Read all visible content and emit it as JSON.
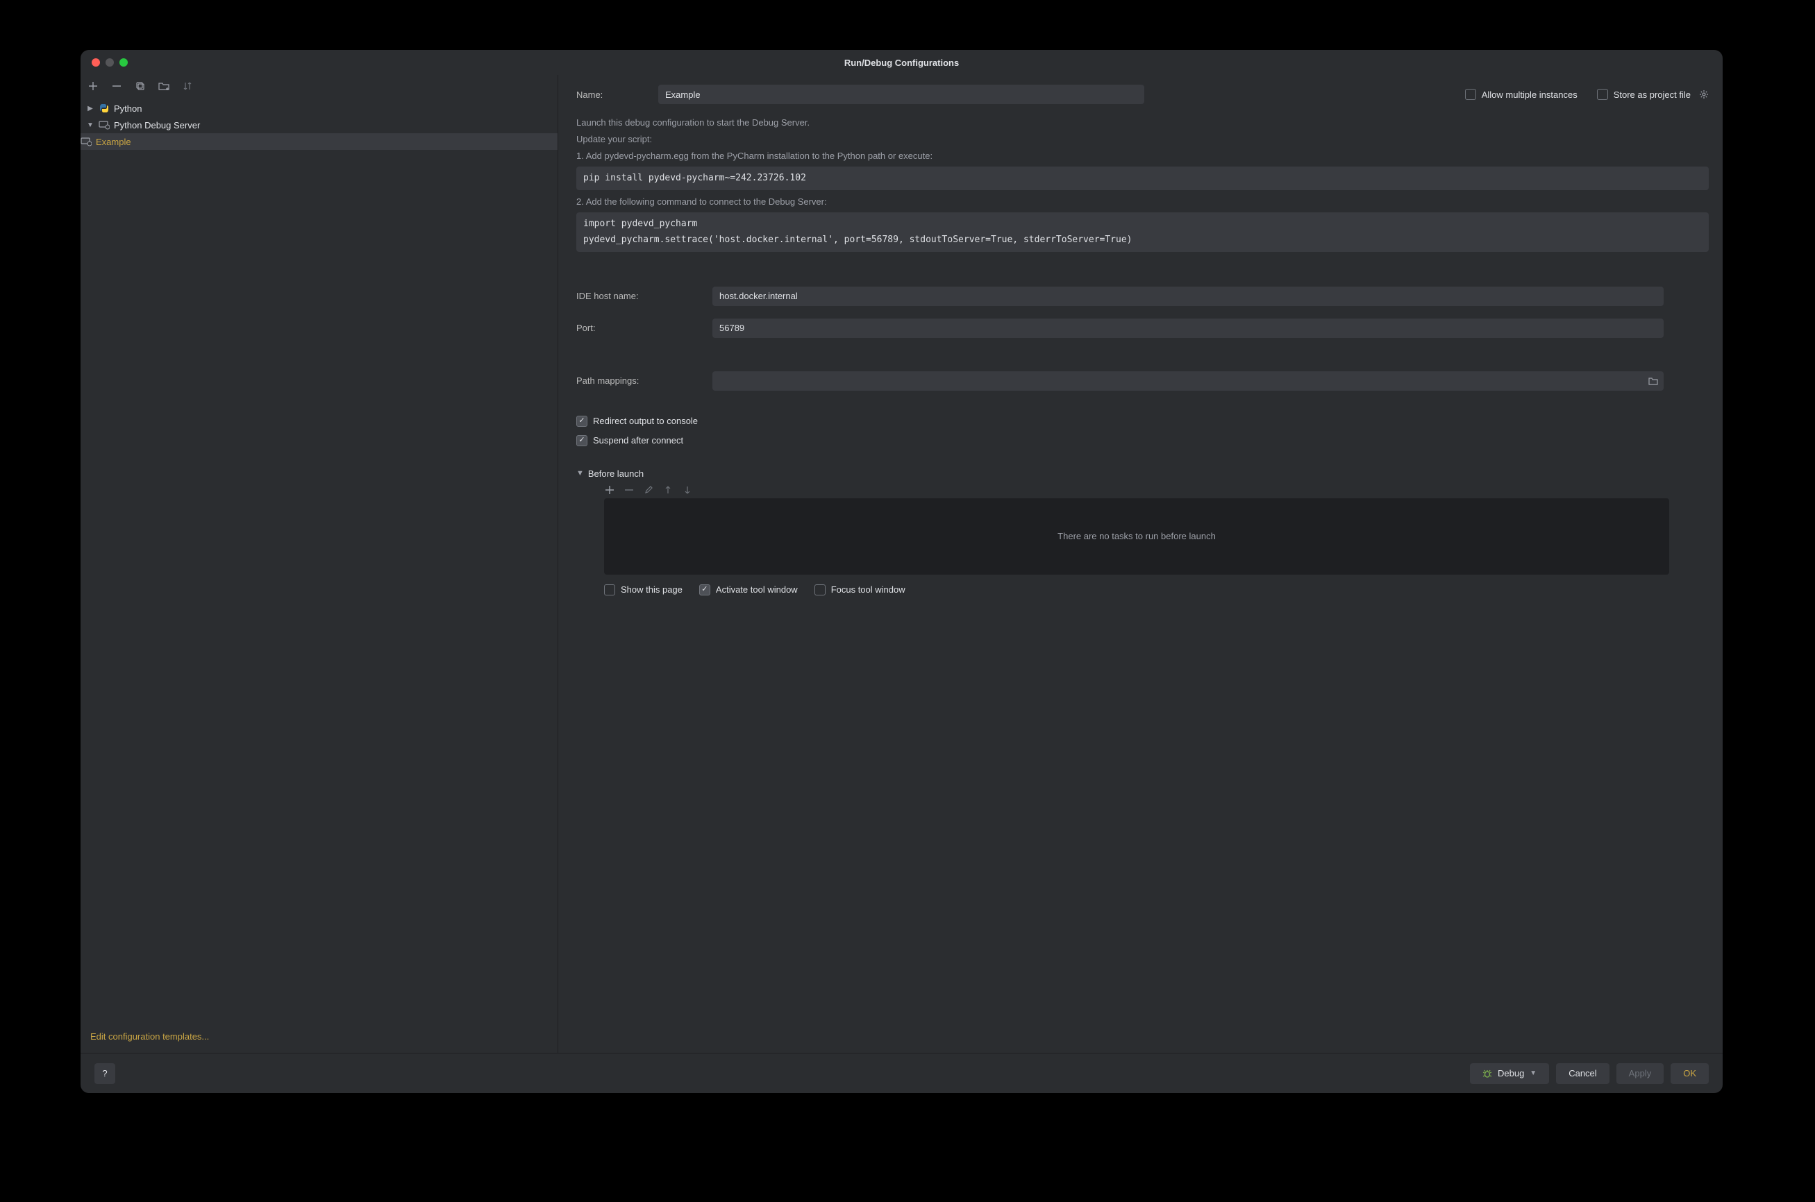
{
  "titlebar": {
    "title": "Run/Debug Configurations"
  },
  "sidebar": {
    "edit_templates": "Edit configuration templates...",
    "tree": {
      "python_label": "Python",
      "debug_server_label": "Python Debug Server",
      "example_label": "Example"
    }
  },
  "form": {
    "name_label": "Name:",
    "name_value": "Example",
    "allow_multi_label": "Allow multiple instances",
    "store_project_label": "Store as project file",
    "desc1": "Launch this debug configuration to start the Debug Server.",
    "desc2": "Update your script:",
    "desc3": "1. Add pydevd-pycharm.egg from the PyCharm installation to the Python path or execute:",
    "code1": "pip install pydevd-pycharm~=242.23726.102",
    "desc4": "2. Add the following command to connect to the Debug Server:",
    "code2": "import pydevd_pycharm\npydevd_pycharm.settrace('host.docker.internal', port=56789, stdoutToServer=True, stderrToServer=True)",
    "host_label": "IDE host name:",
    "host_value": "host.docker.internal",
    "port_label": "Port:",
    "port_value": "56789",
    "path_label": "Path mappings:",
    "path_value": "",
    "redirect_label": "Redirect output to console",
    "suspend_label": "Suspend after connect",
    "before_launch_label": "Before launch",
    "bl_empty": "There are no tasks to run before launch",
    "show_page_label": "Show this page",
    "activate_tw_label": "Activate tool window",
    "focus_tw_label": "Focus tool window"
  },
  "footer": {
    "help": "?",
    "debug": "Debug",
    "cancel": "Cancel",
    "apply": "Apply",
    "ok": "OK"
  }
}
